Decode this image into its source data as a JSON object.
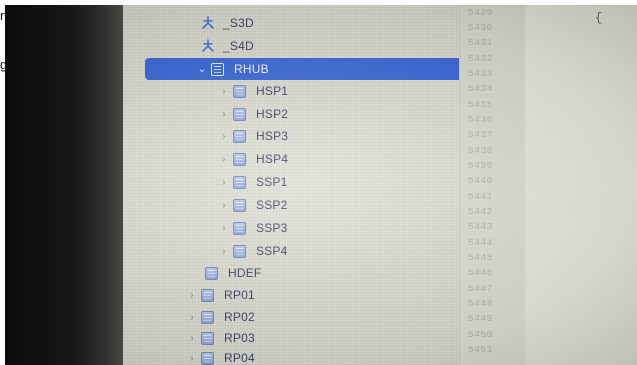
{
  "edge_fragments": [
    "n",
    "g"
  ],
  "tree": {
    "items": [
      {
        "label": "_S3D",
        "icon": "method-icon",
        "expandable": false,
        "selected": false
      },
      {
        "label": "_S4D",
        "icon": "method-icon",
        "expandable": false,
        "selected": false
      },
      {
        "label": "RHUB",
        "icon": "device-icon",
        "expandable": true,
        "expanded": true,
        "selected": true
      },
      {
        "label": "HSP1",
        "icon": "device-icon",
        "expandable": true,
        "selected": false
      },
      {
        "label": "HSP2",
        "icon": "device-icon",
        "expandable": true,
        "selected": false
      },
      {
        "label": "HSP3",
        "icon": "device-icon",
        "expandable": true,
        "selected": false
      },
      {
        "label": "HSP4",
        "icon": "device-icon",
        "expandable": true,
        "selected": false
      },
      {
        "label": "SSP1",
        "icon": "device-icon",
        "expandable": true,
        "selected": false
      },
      {
        "label": "SSP2",
        "icon": "device-icon",
        "expandable": true,
        "selected": false
      },
      {
        "label": "SSP3",
        "icon": "device-icon",
        "expandable": true,
        "selected": false
      },
      {
        "label": "SSP4",
        "icon": "device-icon",
        "expandable": true,
        "selected": false
      },
      {
        "label": "HDEF",
        "icon": "device-icon",
        "expandable": false,
        "selected": false
      },
      {
        "label": "RP01",
        "icon": "device-icon",
        "expandable": true,
        "selected": false
      },
      {
        "label": "RP02",
        "icon": "device-icon",
        "expandable": true,
        "selected": false
      },
      {
        "label": "RP03",
        "icon": "device-icon",
        "expandable": true,
        "selected": false
      },
      {
        "label": "RP04",
        "icon": "device-icon",
        "expandable": true,
        "selected": false
      }
    ]
  },
  "line_numbers": [
    "5429",
    "5430",
    "5431",
    "5432",
    "5433",
    "5434",
    "5435",
    "5436",
    "5437",
    "5438",
    "5439",
    "5440",
    "5441",
    "5442",
    "5443",
    "5444",
    "5445",
    "5446",
    "5447",
    "5448",
    "5449",
    "5450",
    "5451"
  ],
  "editor": {
    "visible_text": "{"
  },
  "colors": {
    "selection": "#3a66d6",
    "tree_text": "#3b4468",
    "device_icon": "#8fa7dc",
    "method_icon": "#4a72d8",
    "line_number": "#b4b4ad"
  }
}
